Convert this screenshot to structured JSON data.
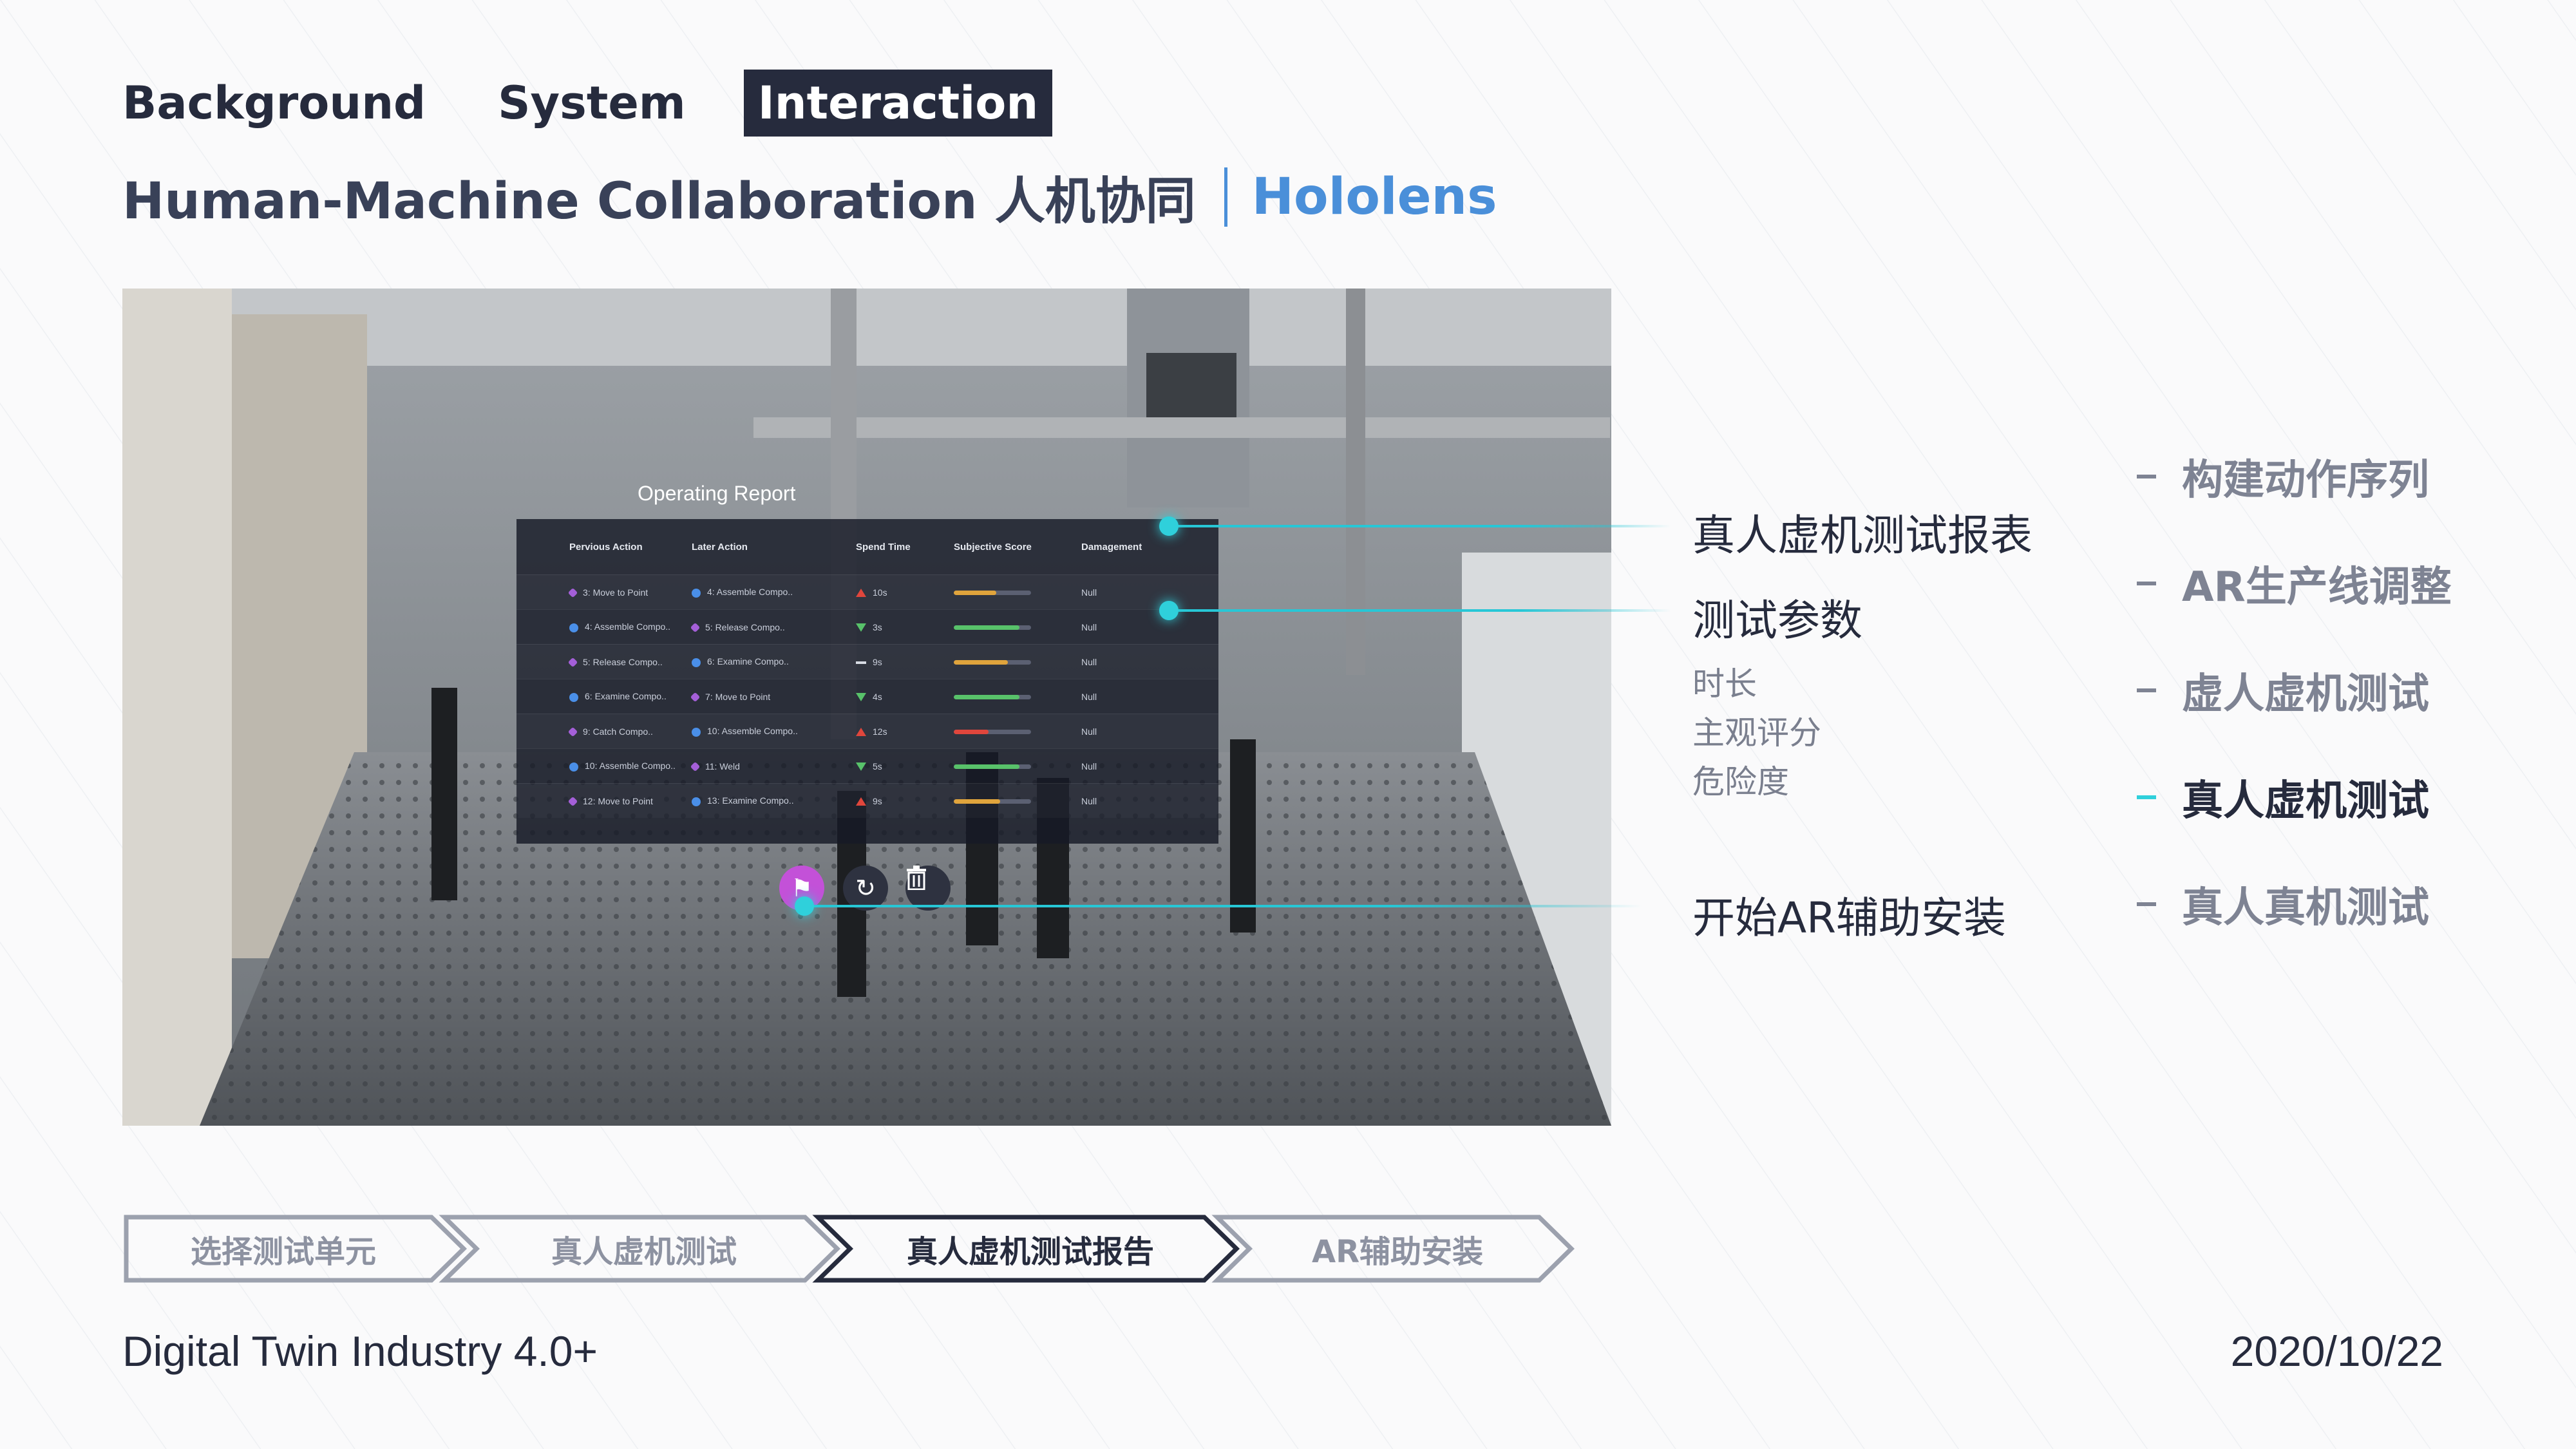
{
  "nav": {
    "tabs": [
      {
        "label": "Background",
        "active": false
      },
      {
        "label": "System",
        "active": false
      },
      {
        "label": "Interaction",
        "active": true
      }
    ]
  },
  "subtitle": {
    "main": "Human-Machine Collaboration 人机协同",
    "highlight": "Hololens"
  },
  "report": {
    "title": "Operating Report",
    "headers": [
      "Pervious Action",
      "Later Action",
      "Spend Time",
      "Subjective Score",
      "Damagement"
    ],
    "rows": [
      {
        "prev": "3: Move to Point",
        "later": "4: Assemble Compo..",
        "trend": "up",
        "time": "10s",
        "score": 0.55,
        "score_color": "#e0a43c",
        "damage": "Null"
      },
      {
        "prev": "4: Assemble Compo..",
        "later": "5: Release Compo..",
        "trend": "down",
        "time": "3s",
        "score": 0.85,
        "score_color": "#58c26a",
        "damage": "Null"
      },
      {
        "prev": "5: Release Compo..",
        "later": "6: Examine Compo..",
        "trend": "flat",
        "time": "9s",
        "score": 0.7,
        "score_color": "#e0a43c",
        "damage": "Null"
      },
      {
        "prev": "6: Examine Compo..",
        "later": "7: Move to Point",
        "trend": "down",
        "time": "4s",
        "score": 0.85,
        "score_color": "#58c26a",
        "damage": "Null"
      },
      {
        "prev": "9: Catch Compo..",
        "later": "10: Assemble Compo..",
        "trend": "up",
        "time": "12s",
        "score": 0.45,
        "score_color": "#e0463c",
        "damage": "Null"
      },
      {
        "prev": "10: Assemble Compo..",
        "later": "11: Weld",
        "trend": "down",
        "time": "5s",
        "score": 0.85,
        "score_color": "#58c26a",
        "damage": "Null"
      },
      {
        "prev": "12: Move to Point",
        "later": "13: Examine Compo..",
        "trend": "up",
        "time": "9s",
        "score": 0.6,
        "score_color": "#e0a43c",
        "damage": "Null"
      }
    ]
  },
  "callouts": {
    "report_table": "真人虚机测试报表",
    "test_params": "测试参数",
    "param_items": [
      "时长",
      "主观评分",
      "危险度"
    ],
    "start_ar": "开始AR辅助安装"
  },
  "steps": [
    {
      "label": "构建动作序列",
      "active": false
    },
    {
      "label": "AR生产线调整",
      "active": false
    },
    {
      "label": "虚人虚机测试",
      "active": false
    },
    {
      "label": "真人虚机测试",
      "active": true
    },
    {
      "label": "真人真机测试",
      "active": false
    }
  ],
  "flow": [
    {
      "label": "选择测试单元",
      "active": false
    },
    {
      "label": "真人虚机测试",
      "active": false
    },
    {
      "label": "真人虚机测试报告",
      "active": true
    },
    {
      "label": "AR辅助安装",
      "active": false
    }
  ],
  "footer": {
    "left": "Digital Twin Industry 4.0+",
    "right": "2020/10/22"
  },
  "colors": {
    "accent": "#2fd0db",
    "highlight": "#4a8fd9",
    "dark": "#262b3d"
  }
}
